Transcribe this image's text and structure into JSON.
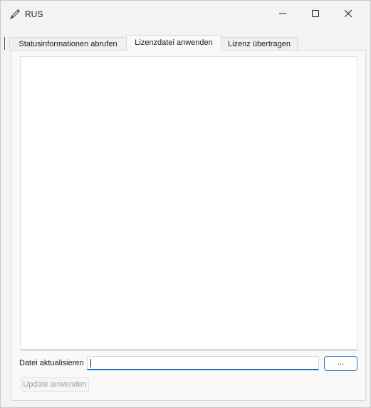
{
  "window": {
    "title": "RUS",
    "icon": "pen-icon",
    "controls": {
      "minimize": "minimize-icon",
      "maximize": "maximize-icon",
      "close": "close-icon"
    }
  },
  "tabs": [
    {
      "label": "Statusinformationen abrufen",
      "active": false
    },
    {
      "label": "Lizenzdatei anwenden",
      "active": true
    },
    {
      "label": "Lizenz übertragen",
      "active": false
    }
  ],
  "panel": {
    "file_label": "Datei aktualisieren",
    "file_value": "",
    "browse_label": "...",
    "apply_label": "Update anwenden",
    "apply_enabled": false
  },
  "colors": {
    "accent": "#1f6fb8",
    "window_bg": "#f3f3f3",
    "disabled_text": "#a0a0a0"
  }
}
